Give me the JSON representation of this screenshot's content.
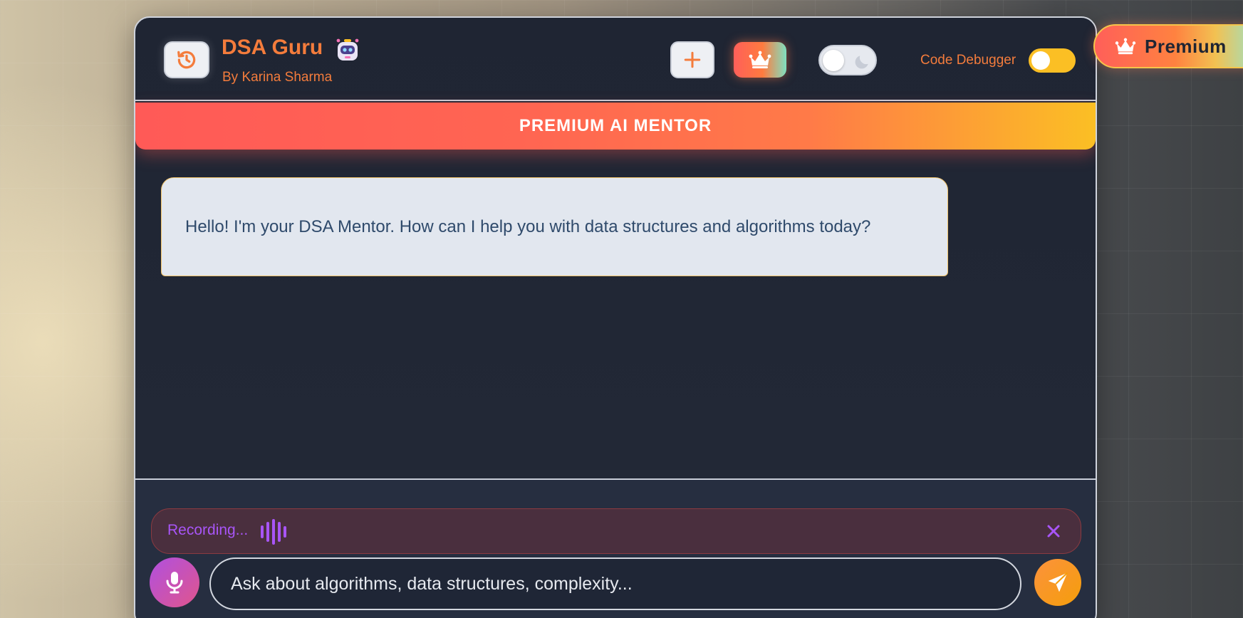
{
  "header": {
    "title": "DSA Guru",
    "subtitle": "By Karina Sharma",
    "debugger_label": "Code Debugger",
    "debugger_on": true,
    "theme": "light"
  },
  "banner": {
    "text": "PREMIUM AI MENTOR"
  },
  "messages": [
    {
      "role": "assistant",
      "text": "Hello! I'm your DSA Mentor. How can I help you with data structures and algorithms today?"
    }
  ],
  "recording": {
    "label": "Recording..."
  },
  "composer": {
    "placeholder": "Ask about algorithms, data structures, complexity..."
  },
  "premium_badge": {
    "label": "Premium"
  },
  "icons": {
    "history": "history-icon",
    "new_chat": "plus-icon",
    "premium": "crown-icon",
    "theme": "moon-icon",
    "mic": "microphone-icon",
    "send": "send-icon",
    "close": "close-icon",
    "bot": "robot-icon",
    "wave": "waveform-icon"
  },
  "colors": {
    "accent_orange": "#f47c3c",
    "recording_purple": "#a855f7",
    "toggle_yellow": "#fbbf24",
    "banner_red": "#ff5a57"
  }
}
